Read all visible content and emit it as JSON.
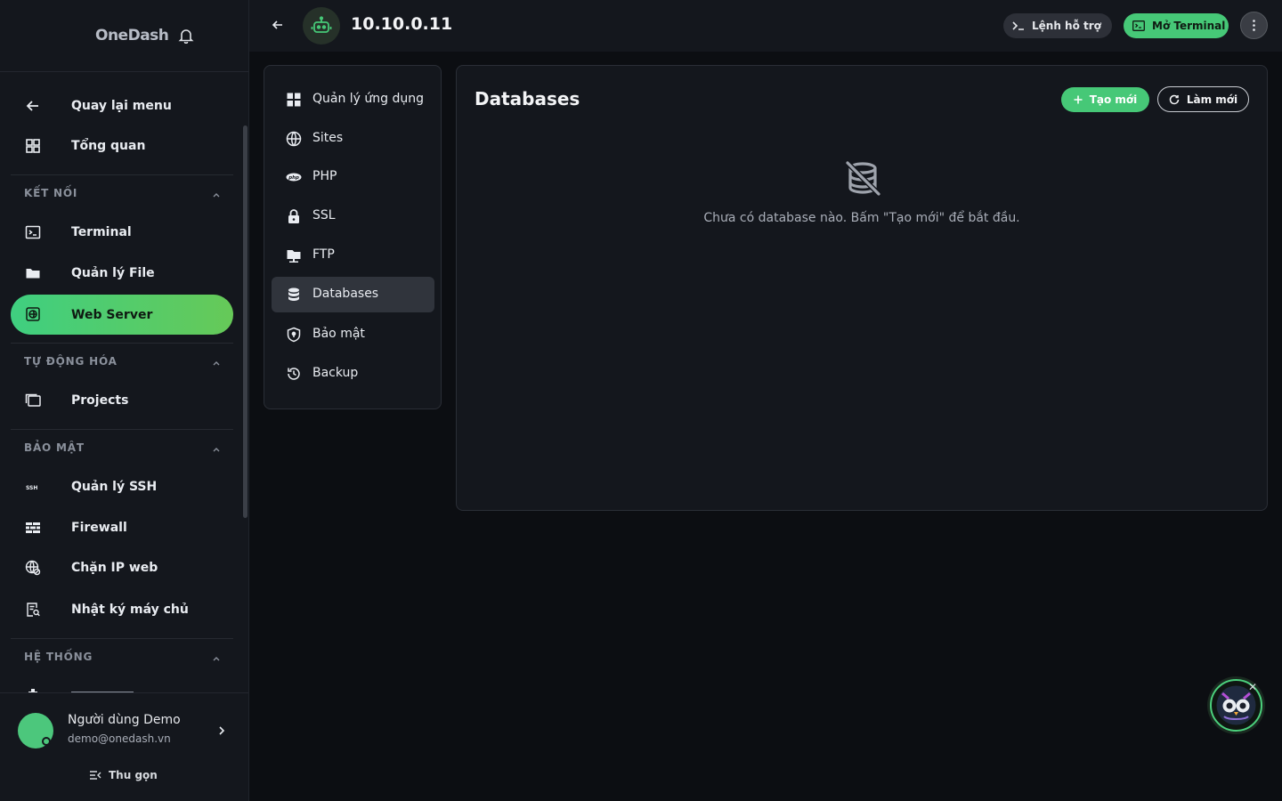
{
  "app": {
    "name": "OneDash"
  },
  "sidebar": {
    "back_label": "Quay lại menu",
    "overview_label": "Tổng quan",
    "sections": [
      {
        "title": "KẾT NỐI",
        "items": [
          "Terminal",
          "Quản lý File",
          "Web Server"
        ]
      },
      {
        "title": "TỰ ĐỘNG HÓA",
        "items": [
          "Projects"
        ]
      },
      {
        "title": "BẢO MẬT",
        "items": [
          "Quản lý SSH",
          "Firewall",
          "Chặn IP web",
          "Nhật ký máy chủ"
        ]
      },
      {
        "title": "HỆ THỐNG",
        "items": []
      }
    ],
    "active_item": "Web Server"
  },
  "user": {
    "name": "Người dùng Demo",
    "email": "demo@onedash.vn",
    "collapse_label": "Thu gọn"
  },
  "topbar": {
    "server": "10.10.0.11",
    "help_label": "Lệnh hỗ trợ",
    "terminal_label": "Mở Terminal"
  },
  "submenu": {
    "items": [
      "Quản lý ứng dụng",
      "Sites",
      "PHP",
      "SSL",
      "FTP",
      "Databases",
      "Bảo mật",
      "Backup"
    ],
    "active": "Databases"
  },
  "content": {
    "title": "Databases",
    "create_label": "Tạo mới",
    "refresh_label": "Làm mới",
    "empty_text": "Chưa có database nào. Bấm \"Tạo mới\" để bắt đầu."
  },
  "colors": {
    "accent": "#46c877",
    "background": "#0c0e12",
    "panel": "#14171d"
  },
  "icons": [
    "bell-icon",
    "arrow-left-icon",
    "dashboard-icon",
    "terminal-icon",
    "folder-icon",
    "globe-icon",
    "projects-icon",
    "ssh-icon",
    "firewall-icon",
    "block-ip-icon",
    "log-icon",
    "robot-icon",
    "grid-icon",
    "php-icon",
    "lock-icon",
    "ftp-icon",
    "database-icon",
    "shield-icon",
    "backup-icon",
    "plus-icon",
    "refresh-icon",
    "database-off-icon",
    "owl-icon"
  ]
}
